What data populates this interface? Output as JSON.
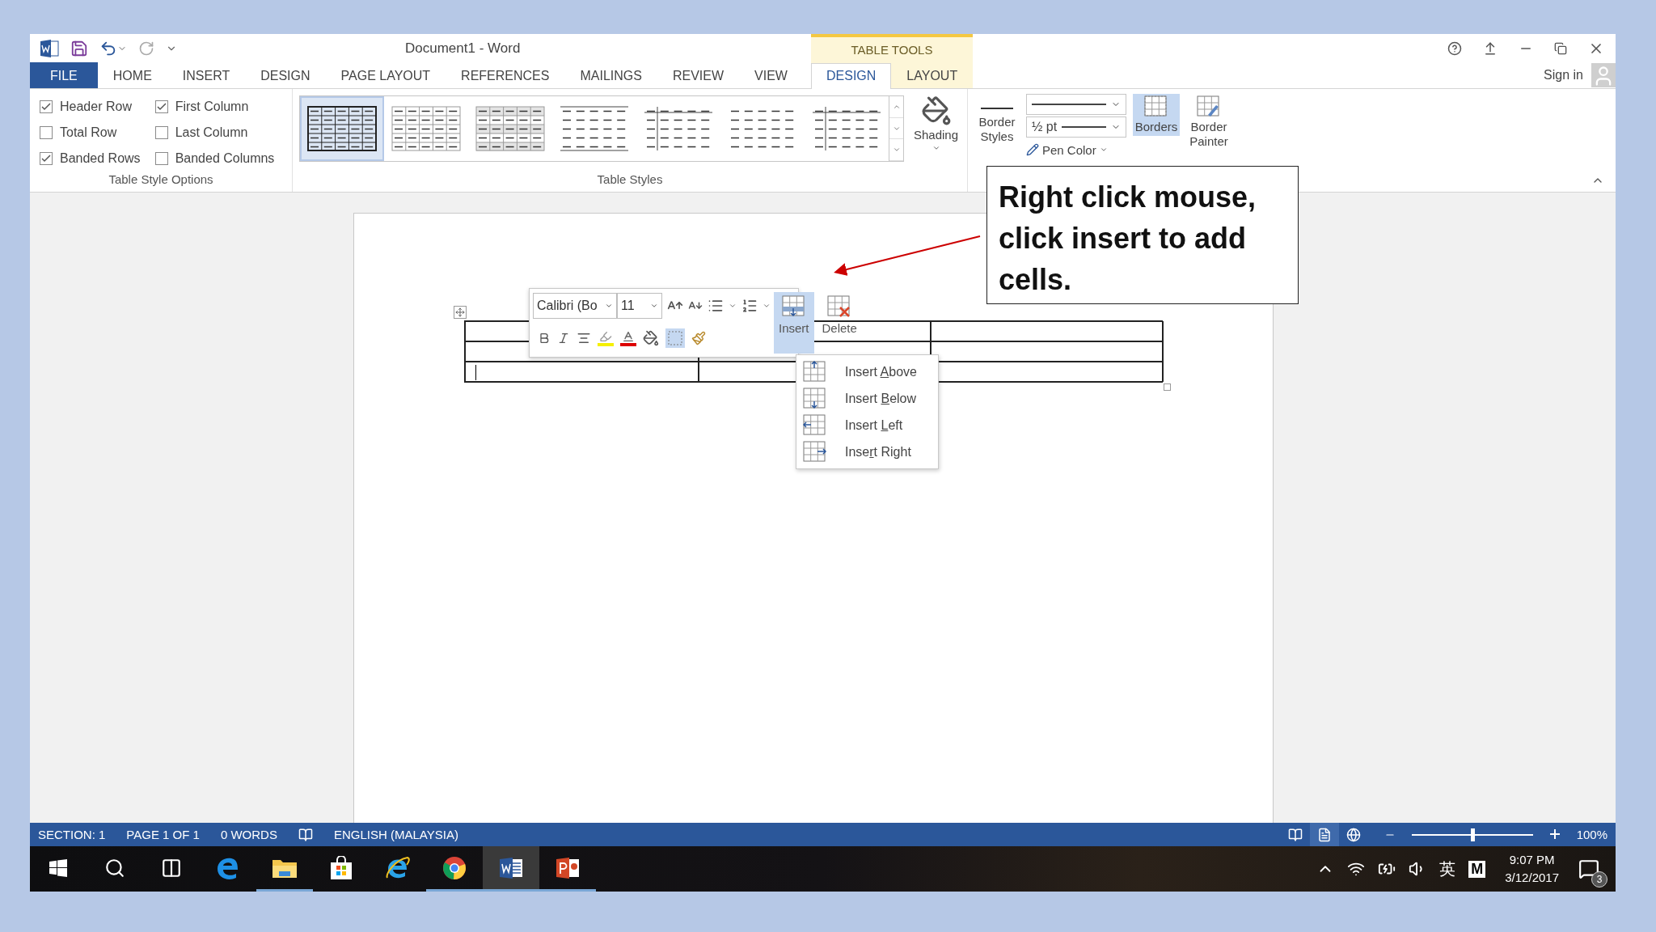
{
  "window": {
    "title": "Document1 - Word",
    "context_header": "TABLE TOOLS"
  },
  "ribbon_tabs": [
    {
      "label": "FILE",
      "kind": "file",
      "selected": false
    },
    {
      "label": "HOME",
      "kind": "normal",
      "selected": false
    },
    {
      "label": "INSERT",
      "kind": "normal",
      "selected": false
    },
    {
      "label": "DESIGN",
      "kind": "normal",
      "selected": false
    },
    {
      "label": "PAGE LAYOUT",
      "kind": "normal",
      "selected": false
    },
    {
      "label": "REFERENCES",
      "kind": "normal",
      "selected": false
    },
    {
      "label": "MAILINGS",
      "kind": "normal",
      "selected": false
    },
    {
      "label": "REVIEW",
      "kind": "normal",
      "selected": false
    },
    {
      "label": "VIEW",
      "kind": "normal",
      "selected": false
    },
    {
      "label": "DESIGN",
      "kind": "contextual",
      "selected": true
    },
    {
      "label": "LAYOUT",
      "kind": "contextual",
      "selected": false
    }
  ],
  "account": {
    "label": "Sign in"
  },
  "style_options": {
    "label": "Table Style Options",
    "items": [
      {
        "label": "Header Row",
        "checked": true
      },
      {
        "label": "Total Row",
        "checked": false
      },
      {
        "label": "Banded Rows",
        "checked": true
      },
      {
        "label": "First Column",
        "checked": true
      },
      {
        "label": "Last Column",
        "checked": false
      },
      {
        "label": "Banded Columns",
        "checked": false
      }
    ]
  },
  "table_styles": {
    "label": "Table Styles",
    "styles": [
      {
        "kind": "grid",
        "selected": true
      },
      {
        "kind": "light-grid",
        "selected": false
      },
      {
        "kind": "shaded-grid",
        "selected": false
      },
      {
        "kind": "lines",
        "selected": false
      },
      {
        "kind": "first-column",
        "selected": false
      },
      {
        "kind": "plain",
        "selected": false
      },
      {
        "kind": "first-column",
        "selected": false
      }
    ]
  },
  "shading": {
    "label": "Shading"
  },
  "borders_group": {
    "border_styles": "Border Styles",
    "line_weight": "½ pt",
    "pen_color": "Pen Color",
    "buttons": [
      {
        "label": "Borders",
        "kind": "borders",
        "selected": true
      },
      {
        "label": "Border Painter",
        "kind": "painter",
        "selected": false
      }
    ]
  },
  "mini_toolbar": {
    "font": "Calibri (Bo",
    "size": "11",
    "buttons": [
      {
        "label": "Insert",
        "kind": "insert",
        "selected": true
      },
      {
        "label": "Delete",
        "kind": "delete",
        "selected": false
      }
    ]
  },
  "insert_menu": [
    {
      "before": "Insert ",
      "key": "A",
      "after": "bove",
      "kind": "above"
    },
    {
      "before": "Insert ",
      "key": "B",
      "after": "elow",
      "kind": "below"
    },
    {
      "before": "Insert ",
      "key": "L",
      "after": "eft",
      "kind": "left"
    },
    {
      "before": "Inse",
      "key": "r",
      "after": "t Right",
      "kind": "right"
    }
  ],
  "callout": {
    "text": "Right click mouse, click insert to add cells."
  },
  "status_bar": {
    "items": [
      "SECTION: 1",
      "PAGE 1 OF 1",
      "0 WORDS"
    ],
    "language": "ENGLISH (MALAYSIA)",
    "views": [
      {
        "kind": "read",
        "selected": false
      },
      {
        "kind": "print",
        "selected": true
      },
      {
        "kind": "web",
        "selected": false
      }
    ],
    "zoom": {
      "level": 0.5,
      "reading": "100%"
    }
  },
  "taskbar": {
    "apps": [
      {
        "kind": "start",
        "running": false,
        "active": false
      },
      {
        "kind": "search",
        "running": false,
        "active": false
      },
      {
        "kind": "task-view",
        "running": false,
        "active": false
      },
      {
        "kind": "edge",
        "running": false,
        "active": false
      },
      {
        "kind": "explorer",
        "running": true,
        "active": false
      },
      {
        "kind": "store",
        "running": false,
        "active": false
      },
      {
        "kind": "ie",
        "running": false,
        "active": false
      },
      {
        "kind": "chrome",
        "running": true,
        "active": false
      },
      {
        "kind": "word",
        "running": true,
        "active": true
      },
      {
        "kind": "powerpoint",
        "running": true,
        "active": false
      }
    ],
    "tray": {
      "ime": "英",
      "badge": "M",
      "time": "9:07 PM",
      "date": "3/12/2017",
      "notifications": "3"
    }
  }
}
